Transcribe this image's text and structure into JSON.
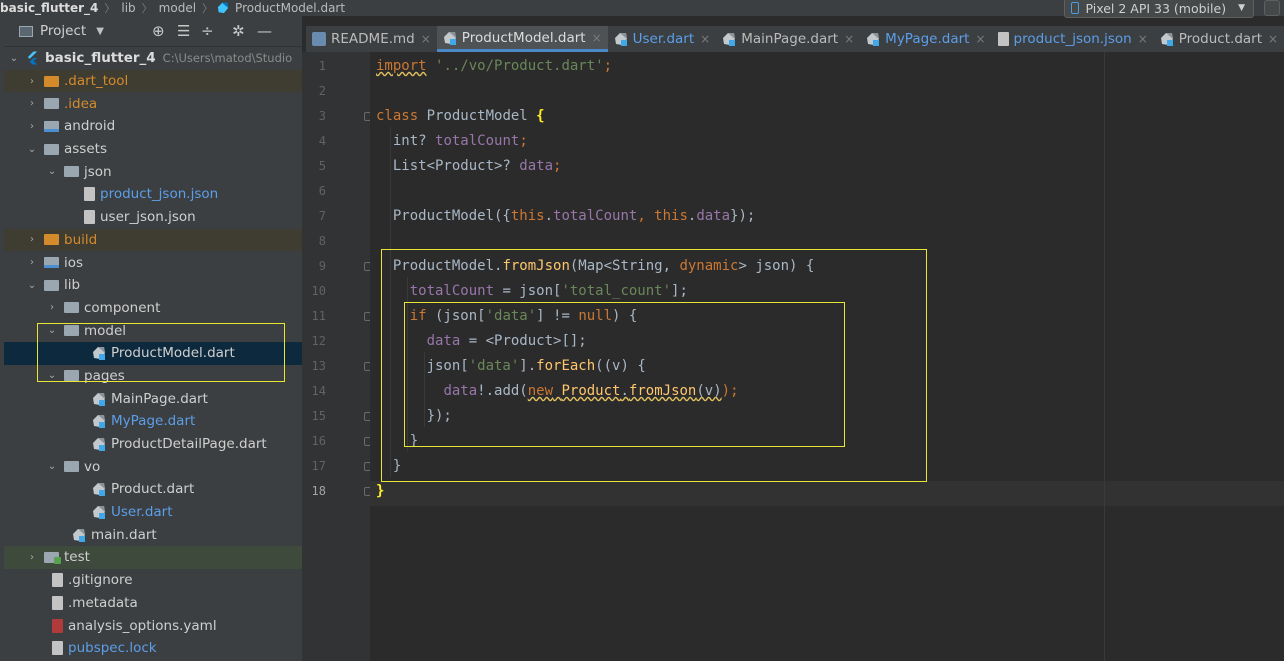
{
  "navbar": {
    "crumbs": [
      "basic_flutter_4",
      "lib",
      "model",
      "ProductModel.dart"
    ],
    "device": "Pixel 2 API 33 (mobile)"
  },
  "project_panel": {
    "title": "Project",
    "tree": [
      {
        "label": "basic_flutter_4",
        "path": "C:\\Users\\matod\\Studio"
      },
      {
        "label": ".dart_tool"
      },
      {
        "label": ".idea"
      },
      {
        "label": "android"
      },
      {
        "label": "assets"
      },
      {
        "label": "json"
      },
      {
        "label": "product_json.json"
      },
      {
        "label": "user_json.json"
      },
      {
        "label": "build"
      },
      {
        "label": "ios"
      },
      {
        "label": "lib"
      },
      {
        "label": "component"
      },
      {
        "label": "model"
      },
      {
        "label": "ProductModel.dart"
      },
      {
        "label": "pages"
      },
      {
        "label": "MainPage.dart"
      },
      {
        "label": "MyPage.dart"
      },
      {
        "label": "ProductDetailPage.dart"
      },
      {
        "label": "vo"
      },
      {
        "label": "Product.dart"
      },
      {
        "label": "User.dart"
      },
      {
        "label": "main.dart"
      },
      {
        "label": "test"
      },
      {
        "label": ".gitignore"
      },
      {
        "label": ".metadata"
      },
      {
        "label": "analysis_options.yaml"
      },
      {
        "label": "pubspec.lock"
      }
    ]
  },
  "tabs": [
    {
      "label": "README.md"
    },
    {
      "label": "ProductModel.dart"
    },
    {
      "label": "User.dart"
    },
    {
      "label": "MainPage.dart"
    },
    {
      "label": "MyPage.dart"
    },
    {
      "label": "product_json.json"
    },
    {
      "label": "Product.dart"
    }
  ],
  "editor": {
    "line_numbers": [
      "1",
      "2",
      "3",
      "4",
      "5",
      "6",
      "7",
      "8",
      "9",
      "10",
      "11",
      "12",
      "13",
      "14",
      "15",
      "16",
      "17",
      "18"
    ],
    "current_line": "18",
    "code": [
      {
        "a": "import",
        "b": " ",
        "c": "'../vo/Product.dart'",
        "d": ";"
      },
      {},
      {
        "a": "class",
        "b": " ProductModel ",
        "c": "{"
      },
      {
        "a": "  int? ",
        "b": "totalCount",
        "c": ";"
      },
      {
        "a": "  List<Product>? ",
        "b": "data",
        "c": ";"
      },
      {},
      {
        "a": "  ProductModel({",
        "b": "this",
        "c": ".",
        "d": "totalCount",
        "e": ", ",
        "f": "this",
        "g": ".",
        "h": "data",
        "i": "});"
      },
      {},
      {
        "a": "  ProductModel.",
        "b": "fromJson",
        "c": "(Map<String, ",
        "d": "dynamic",
        "e": "> json) {"
      },
      {
        "a": "    ",
        "b": "totalCount",
        "c": " = json[",
        "d": "'total_count'",
        "e": "];"
      },
      {
        "a": "    ",
        "b": "if",
        "c": " (json[",
        "d": "'data'",
        "e": "] != ",
        "f": "null",
        "g": ") {"
      },
      {
        "a": "      ",
        "b": "data",
        "c": " = <Product>[];"
      },
      {
        "a": "      json[",
        "b": "'data'",
        "c": "].",
        "d": "forEach",
        "e": "((v) {"
      },
      {
        "a": "        ",
        "b": "data",
        "c": "!.add(",
        "d": "new",
        "e": " ",
        "f": "Product",
        "g": ".",
        "h": "fromJson",
        "i": "(v)",
        "j": ");"
      },
      {
        "a": "      });"
      },
      {
        "a": "    }"
      },
      {
        "a": "  }"
      },
      {
        "a": "}"
      }
    ]
  }
}
